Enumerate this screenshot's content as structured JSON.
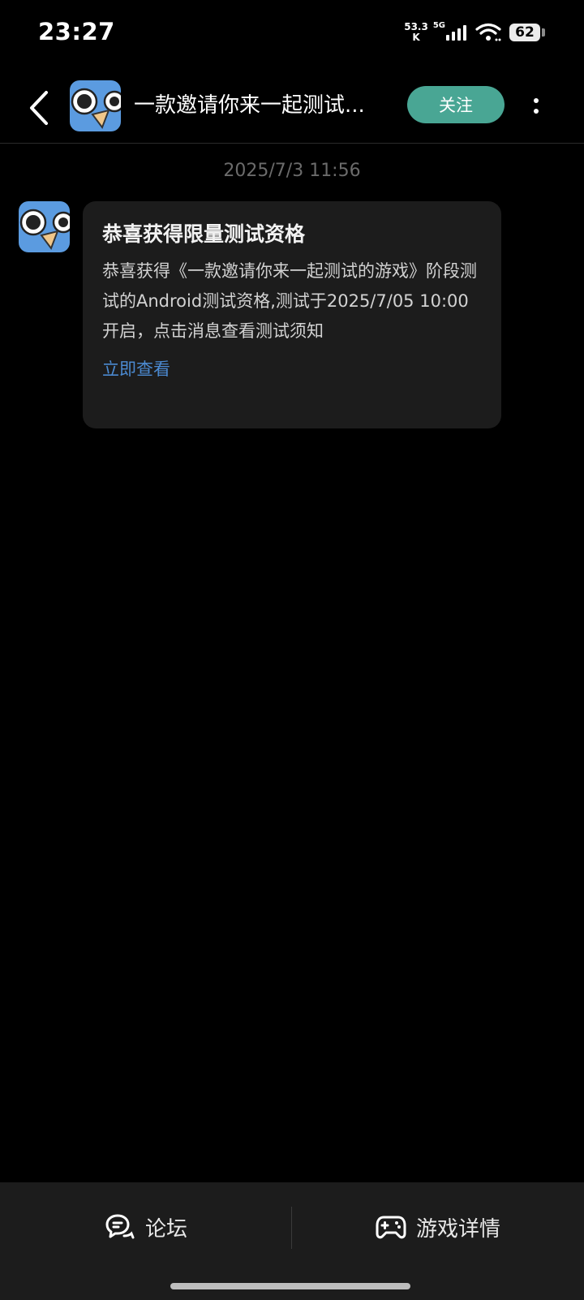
{
  "status_bar": {
    "time": "23:27",
    "net_speed_value": "53.3",
    "net_speed_unit": "K",
    "network": "5G",
    "battery": "62"
  },
  "header": {
    "title": "一款邀请你来一起测试...",
    "follow_label": "关注",
    "icons": [
      "back-icon",
      "more-icon"
    ]
  },
  "chat": {
    "timestamp": "2025/7/3  11:56",
    "message": {
      "title": "恭喜获得限量测试资格",
      "body": "恭喜获得《一款邀请你来一起测试的游戏》阶段测试的Android测试资格,测试于2025/7/05 10:00 开启，点击消息查看测试须知",
      "link": "立即查看"
    }
  },
  "bottom_bar": {
    "forum_label": "论坛",
    "details_label": "游戏详情",
    "icons": [
      "forum-icon",
      "gamepad-icon"
    ]
  },
  "colors": {
    "accent": "#49a694",
    "link": "#4b8ad1",
    "card_bg": "#1c1c1c",
    "background": "#000000"
  }
}
